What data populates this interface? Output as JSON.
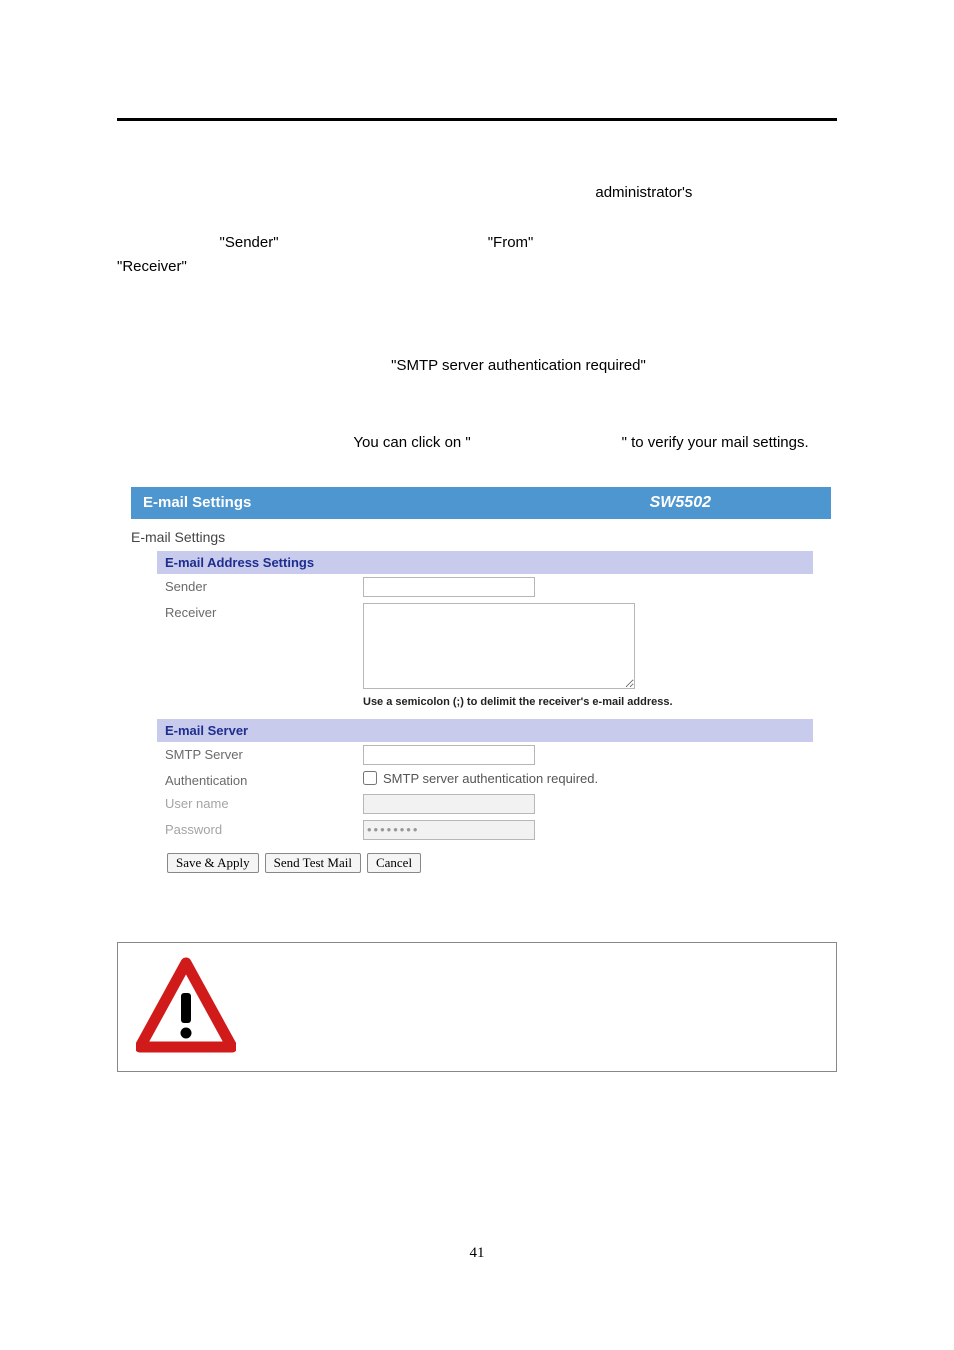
{
  "body": {
    "admin_word": "administrator's",
    "sender_q": "\"Sender\"",
    "from_q": "\"From\"",
    "receiver_q": "\"Receiver\"",
    "smtp_req_q": "\"SMTP  server  authentication  required\"",
    "click_on": "You can click on \"",
    "verify": "\" to verify your mail settings."
  },
  "ui": {
    "header_title": "E-mail Settings",
    "model": "SW5502",
    "section_title": "E-mail Settings",
    "addr_header": "E-mail Address Settings",
    "sender_label": "Sender",
    "receiver_label": "Receiver",
    "receiver_hint": "Use a semicolon (;) to delimit the receiver's e-mail address.",
    "server_header": "E-mail Server",
    "smtp_label": "SMTP Server",
    "auth_label": "Authentication",
    "auth_cb_text": "SMTP server authentication required.",
    "user_label": "User name",
    "pass_label": "Password",
    "pass_value": "••••••••",
    "btn_save": "Save & Apply",
    "btn_test": "Send Test Mail",
    "btn_cancel": "Cancel"
  },
  "page_number": "41"
}
